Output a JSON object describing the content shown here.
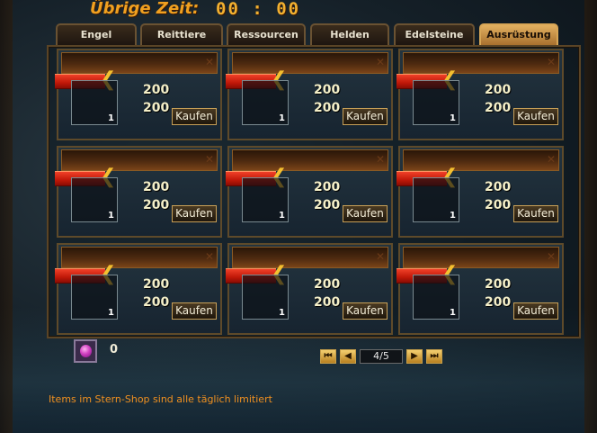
{
  "header": {
    "time_label": "Übrige Zeit:",
    "time_value": "00 : 00"
  },
  "tabs": [
    {
      "label": "Engel",
      "active": false
    },
    {
      "label": "Reittiere",
      "active": false
    },
    {
      "label": "Ressourcen",
      "active": false
    },
    {
      "label": "Helden",
      "active": false
    },
    {
      "label": "Edelsteine",
      "active": false
    },
    {
      "label": "Ausrüstung",
      "active": true
    }
  ],
  "items": [
    {
      "price_1": "200",
      "price_2": "200",
      "count": "1",
      "buy_label": "Kaufen"
    },
    {
      "price_1": "200",
      "price_2": "200",
      "count": "1",
      "buy_label": "Kaufen"
    },
    {
      "price_1": "200",
      "price_2": "200",
      "count": "1",
      "buy_label": "Kaufen"
    },
    {
      "price_1": "200",
      "price_2": "200",
      "count": "1",
      "buy_label": "Kaufen"
    },
    {
      "price_1": "200",
      "price_2": "200",
      "count": "1",
      "buy_label": "Kaufen"
    },
    {
      "price_1": "200",
      "price_2": "200",
      "count": "1",
      "buy_label": "Kaufen"
    },
    {
      "price_1": "200",
      "price_2": "200",
      "count": "1",
      "buy_label": "Kaufen"
    },
    {
      "price_1": "200",
      "price_2": "200",
      "count": "1",
      "buy_label": "Kaufen"
    },
    {
      "price_1": "200",
      "price_2": "200",
      "count": "1",
      "buy_label": "Kaufen"
    }
  ],
  "currency": {
    "icon": "star-gem-icon",
    "amount": "0"
  },
  "pager": {
    "page": "4/5"
  },
  "footer": {
    "note": "Items im Stern-Shop sind alle täglich limitiert"
  },
  "colors": {
    "accent": "#f0a020",
    "active_tab": "#d8a656",
    "ribbon": "#c01808"
  }
}
